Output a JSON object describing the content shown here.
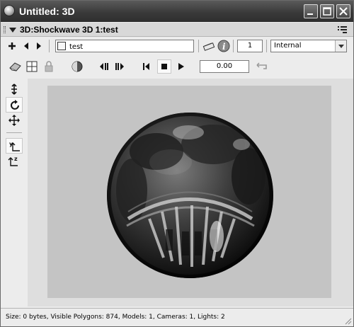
{
  "window": {
    "title": "Untitled: 3D"
  },
  "panel": {
    "title": "3D:Shockwave 3D 1:test"
  },
  "toolbar": {
    "member_name": "test",
    "cast_member_number": "1",
    "cast_library": "Internal",
    "time_value": "0.00"
  },
  "left_tools": [
    "dolly-icon",
    "rotate-icon",
    "pan-icon",
    "y-up-icon",
    "z-up-icon"
  ],
  "status": {
    "text": "Size: 0 bytes, Visible Polygons: 874, Models: 1, Cameras: 1, Lights: 2"
  },
  "colors": {
    "titlebar": "#3a3a3a",
    "stage": "#c4c4c4",
    "panel": "#ececec"
  }
}
